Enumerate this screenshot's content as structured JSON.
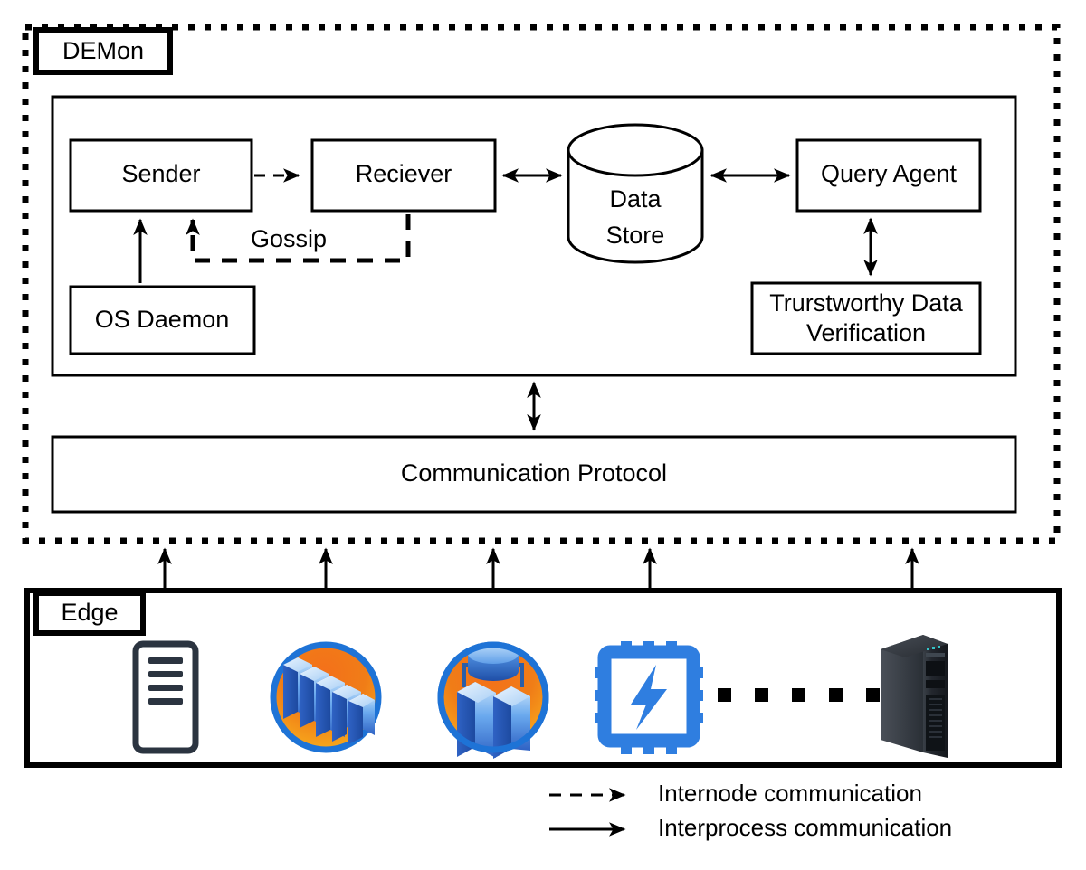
{
  "diagram": {
    "title": "DEMon",
    "outer_frame": {
      "label": "DEMon",
      "style": "dotted"
    },
    "inner_container": {
      "label": ""
    },
    "nodes": {
      "sender": {
        "label": "Sender"
      },
      "receiver": {
        "label": "Reciever"
      },
      "data_store": {
        "label_line1": "Data",
        "label_line2": "Store"
      },
      "query_agent": {
        "label": "Query Agent"
      },
      "trustworthy": {
        "label_line1": "Trurstworthy Data",
        "label_line2": "Verification"
      },
      "os_daemon": {
        "label": "OS Daemon"
      },
      "comm_protocol": {
        "label": "Communication Protocol"
      }
    },
    "edges": {
      "gossip": {
        "label": "Gossip",
        "style": "dashed"
      },
      "sender_to_receiver": {
        "label": "",
        "style": "dashed"
      },
      "receiver_to_store": {
        "label": "",
        "style": "solid-bidir"
      },
      "store_to_query": {
        "label": "",
        "style": "solid-bidir"
      },
      "query_to_trustworthy": {
        "label": "",
        "style": "solid-bidir"
      },
      "osdaemon_to_sender": {
        "label": "",
        "style": "solid"
      },
      "inner_to_comm": {
        "label": "",
        "style": "solid-bidir"
      }
    }
  },
  "edge_section": {
    "label": "Edge",
    "devices": [
      {
        "name": "server-rack-icon",
        "kind": "server-rack"
      },
      {
        "name": "server-cluster-icon",
        "kind": "server-cluster"
      },
      {
        "name": "database-cluster-icon",
        "kind": "database-cluster"
      },
      {
        "name": "cpu-chip-icon",
        "kind": "cpu-chip"
      },
      {
        "name": "ellipsis-dots",
        "kind": "dots"
      },
      {
        "name": "tower-workstation-icon",
        "kind": "tower-pc"
      }
    ],
    "link_count": 5
  },
  "legend": {
    "items": [
      {
        "style": "dashed",
        "label": "Internode communication"
      },
      {
        "style": "solid",
        "label": "Interprocess  communication"
      }
    ]
  },
  "colors": {
    "stroke": "#000000",
    "background": "#ffffff",
    "icon_blue": "#2f7ee0",
    "icon_orange": "#f07d17",
    "icon_amber": "#f7a81b",
    "icon_dark": "#2b3440",
    "icon_light_blue": "#9fd0f5",
    "tower_dark": "#1d2128"
  }
}
